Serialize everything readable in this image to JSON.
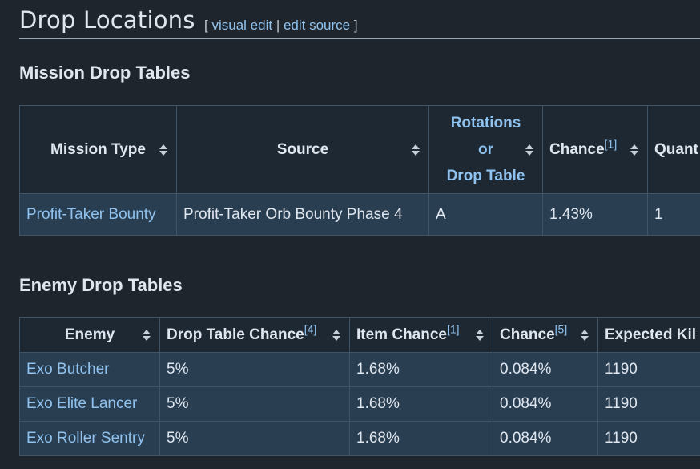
{
  "section": {
    "title": "Drop Locations",
    "edit_open": "[",
    "visual_edit": "visual edit",
    "sep": "|",
    "edit_source": "edit source",
    "edit_close": "]"
  },
  "mission": {
    "heading": "Mission Drop Tables",
    "headers": {
      "mission_type": "Mission Type",
      "source": "Source",
      "rotations_1": "Rotations",
      "rotations_2": "or",
      "rotations_3": "Drop Table",
      "chance": "Chance",
      "chance_ref": "[1]",
      "quantity": "Quant"
    },
    "rows": [
      {
        "mission_type": "Profit-Taker Bounty",
        "source": "Profit-Taker Orb Bounty Phase 4",
        "rotation": "A",
        "chance": "1.43%",
        "quantity": "1"
      }
    ]
  },
  "enemy": {
    "heading": "Enemy Drop Tables",
    "headers": {
      "enemy": "Enemy",
      "drop_table_chance": "Drop Table Chance",
      "drop_table_ref": "[4]",
      "item_chance": "Item Chance",
      "item_ref": "[1]",
      "chance": "Chance",
      "chance_ref": "[5]",
      "expected_kills": "Expected Kil"
    },
    "rows": [
      {
        "enemy": "Exo Butcher",
        "drop_table_chance": "5%",
        "item_chance": "1.68%",
        "chance": "0.084%",
        "expected_kills": "1190"
      },
      {
        "enemy": "Exo Elite Lancer",
        "drop_table_chance": "5%",
        "item_chance": "1.68%",
        "chance": "0.084%",
        "expected_kills": "1190"
      },
      {
        "enemy": "Exo Roller Sentry",
        "drop_table_chance": "5%",
        "item_chance": "1.68%",
        "chance": "0.084%",
        "expected_kills": "1190"
      }
    ]
  }
}
